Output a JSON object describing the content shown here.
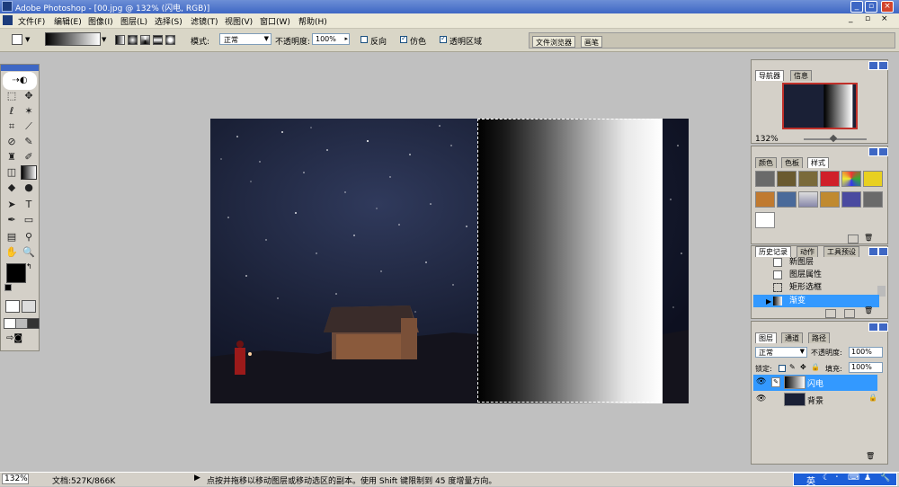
{
  "window": {
    "title": "Adobe Photoshop - [00.jpg @ 132% (闪电, RGB)]",
    "buttons": [
      "_",
      "▫",
      "×"
    ]
  },
  "menu": [
    "文件(F)",
    "编辑(E)",
    "图像(I)",
    "图层(L)",
    "选择(S)",
    "滤镜(T)",
    "视图(V)",
    "窗口(W)",
    "帮助(H)"
  ],
  "doc_buttons": [
    "_",
    "▫",
    "×"
  ],
  "options": {
    "mode_label": "模式:",
    "mode_value": "正常",
    "opacity_label": "不透明度:",
    "opacity_value": "100%",
    "reverse_label": "反向",
    "dither_label": "仿色",
    "transparency_label": "透明区域",
    "reverse_checked": false,
    "dither_checked": true,
    "transparency_checked": true
  },
  "bin_tabs": [
    "文件浏览器",
    "画笔"
  ],
  "navigator": {
    "tabs": [
      "导航器",
      "信息"
    ],
    "zoom": "132%"
  },
  "color_panel": {
    "tabs": [
      "颜色",
      "色板",
      "样式"
    ]
  },
  "history_panel": {
    "tabs": [
      "历史记录",
      "动作",
      "工具预设"
    ],
    "items": [
      "新图层",
      "图层属性",
      "矩形选框",
      "渐变"
    ]
  },
  "layers_panel": {
    "tabs": [
      "图层",
      "通道",
      "路径"
    ],
    "blend_mode": "正常",
    "opacity_label": "不透明度:",
    "opacity_value": "100%",
    "lock_label": "锁定:",
    "fill_label": "填充:",
    "fill_value": "100%",
    "layers": [
      {
        "name": "闪电",
        "selected": true
      },
      {
        "name": "背景",
        "selected": false
      }
    ]
  },
  "status": {
    "zoom": "132%",
    "doc_size": "文档:527K/866K",
    "hint": "点按并拖移以移动图层或移动选区的副本。使用 Shift 键限制到 45 度增量方向。"
  },
  "taskbar": {
    "lang": "英"
  },
  "colors": {
    "title_bar": "#3e67c4",
    "selection_highlight": "#3399ff",
    "workspace": "#c0c0c0"
  }
}
